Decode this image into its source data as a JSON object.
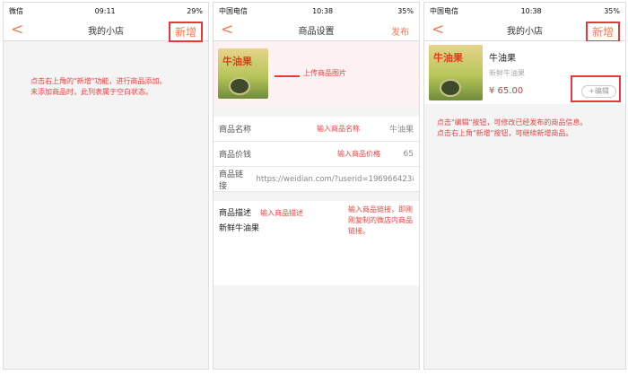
{
  "screen1": {
    "status": {
      "carrier": "微信",
      "time": "09:11",
      "battery": "29%"
    },
    "title": "我的小店",
    "add_label": "新增",
    "note": [
      "点击右上角的\"新增\"功能，进行商品添加。",
      "未添加商品时，此列表属于空白状态。"
    ]
  },
  "screen2": {
    "status": {
      "carrier": "中国电信",
      "time": "10:38",
      "battery": "35%"
    },
    "title": "商品设置",
    "publish_label": "发布",
    "image_label": "牛油果",
    "upload_note": "上传商品图片",
    "rows": [
      {
        "label": "商品名称",
        "value": "牛油果",
        "note": "输入商品名称"
      },
      {
        "label": "商品价钱",
        "value": "65",
        "note": "输入商品价格"
      },
      {
        "label": "商品链接",
        "value": "https://weidian.com/?userid=196966423&..."
      }
    ],
    "link_note": "输入商品链接，即刚刚复制的微店内商品链接。",
    "desc_label": "商品描述",
    "desc_value": "新鲜牛油果",
    "desc_note": "输入商品描述"
  },
  "screen3": {
    "status": {
      "carrier": "中国电信",
      "time": "10:38",
      "battery": "35%"
    },
    "title": "我的小店",
    "add_label": "新增",
    "item": {
      "image_label": "牛油果",
      "name": "牛油果",
      "desc": "新鲜牛油果",
      "price": "¥ 65.00",
      "edit_label": "+编辑"
    },
    "note": [
      "点击\"编辑\"按钮，可修改已经发布的商品信息。",
      "点击右上角\"新增\"按钮，可继续新增商品。"
    ]
  }
}
